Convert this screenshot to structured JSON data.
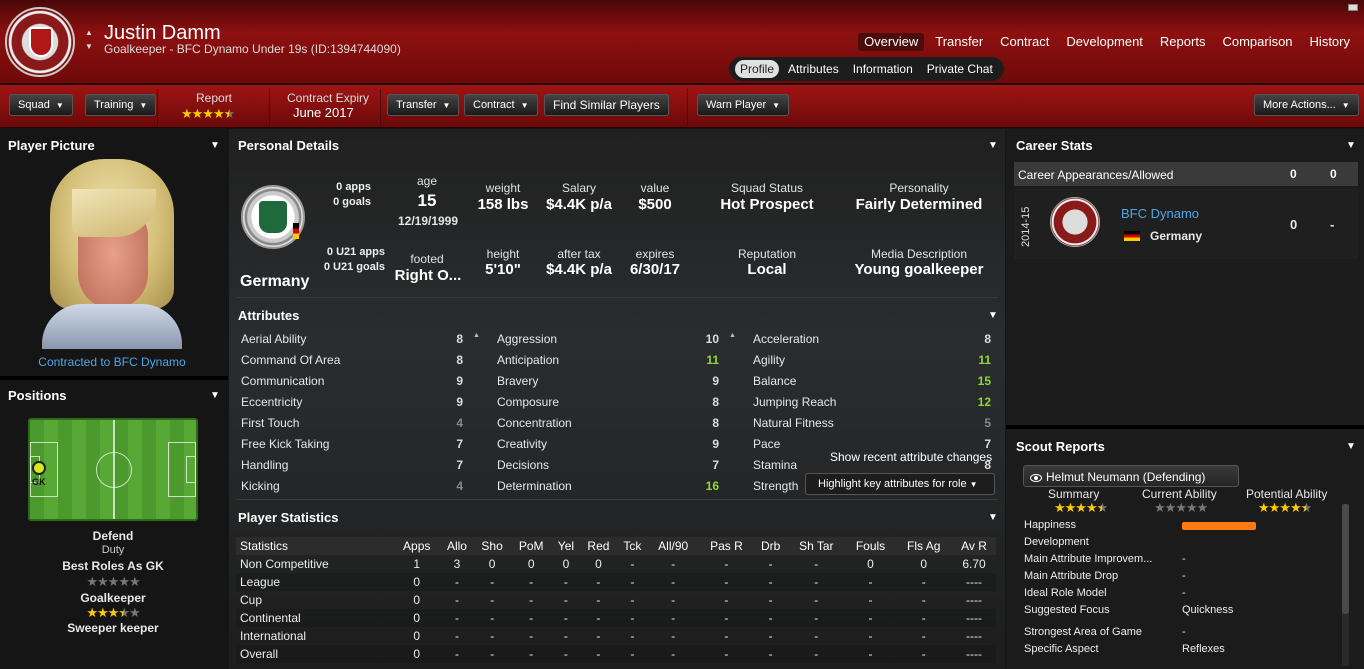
{
  "header": {
    "player_name": "Justin Damm",
    "player_subtitle": "Goalkeeper - BFC Dynamo Under 19s (ID:1394744090)",
    "nav": [
      "Overview",
      "Transfer",
      "Contract",
      "Development",
      "Reports",
      "Comparison",
      "History"
    ],
    "active_nav": "Overview",
    "sub_nav": [
      "Profile",
      "Attributes",
      "Information",
      "Private Chat"
    ],
    "active_sub_nav": "Profile"
  },
  "toolbar": {
    "squad": "Squad",
    "training": "Training",
    "report_label": "Report",
    "report_stars": 4.5,
    "contract_expiry_label": "Contract Expiry",
    "contract_expiry_value": "June 2017",
    "transfer": "Transfer",
    "contract": "Contract",
    "find_similar": "Find Similar Players",
    "warn_player": "Warn Player",
    "more_actions": "More Actions..."
  },
  "player_picture": {
    "title": "Player Picture",
    "contracted": "Contracted to BFC Dynamo"
  },
  "positions": {
    "title": "Positions",
    "pitch_label": "GK",
    "role_duty": "Defend",
    "duty_label": "Duty",
    "best_roles_label": "Best Roles As GK",
    "role1": "Goalkeeper",
    "role1_stars": 0,
    "role2": "Sweeper keeper",
    "role2_stars": 3.5
  },
  "personal": {
    "title": "Personal Details",
    "apps": "0 apps",
    "goals": "0 goals",
    "u21_apps": "0 U21 apps",
    "u21_goals": "0 U21 goals",
    "nation": "Germany",
    "age_label": "age",
    "age": "15",
    "dob": "12/19/1999",
    "footed_label": "footed",
    "footed": "Right O...",
    "weight_label": "weight",
    "weight": "158 lbs",
    "height_label": "height",
    "height": "5'10\"",
    "salary_label": "Salary",
    "salary": "$4.4K p/a",
    "after_tax_label": "after tax",
    "after_tax": "$4.4K p/a",
    "value_label": "value",
    "value": "$500",
    "expires_label": "expires",
    "expires": "6/30/17",
    "squad_status_label": "Squad Status",
    "squad_status": "Hot Prospect",
    "personality_label": "Personality",
    "personality": "Fairly Determined",
    "reputation_label": "Reputation",
    "reputation": "Local",
    "media_label": "Media Description",
    "media": "Young goalkeeper"
  },
  "attributes": {
    "title": "Attributes",
    "col1": [
      {
        "name": "Aerial Ability",
        "value": "8",
        "tone": ""
      },
      {
        "name": "Command Of Area",
        "value": "8",
        "tone": ""
      },
      {
        "name": "Communication",
        "value": "9",
        "tone": ""
      },
      {
        "name": "Eccentricity",
        "value": "9",
        "tone": ""
      },
      {
        "name": "First Touch",
        "value": "4",
        "tone": "d"
      },
      {
        "name": "Free Kick Taking",
        "value": "7",
        "tone": ""
      },
      {
        "name": "Handling",
        "value": "7",
        "tone": ""
      },
      {
        "name": "Kicking",
        "value": "4",
        "tone": "d"
      }
    ],
    "col2": [
      {
        "name": "Aggression",
        "value": "10",
        "tone": ""
      },
      {
        "name": "Anticipation",
        "value": "11",
        "tone": "g"
      },
      {
        "name": "Bravery",
        "value": "9",
        "tone": ""
      },
      {
        "name": "Composure",
        "value": "8",
        "tone": ""
      },
      {
        "name": "Concentration",
        "value": "8",
        "tone": ""
      },
      {
        "name": "Creativity",
        "value": "9",
        "tone": ""
      },
      {
        "name": "Decisions",
        "value": "7",
        "tone": ""
      },
      {
        "name": "Determination",
        "value": "16",
        "tone": "g"
      }
    ],
    "col3": [
      {
        "name": "Acceleration",
        "value": "8",
        "tone": ""
      },
      {
        "name": "Agility",
        "value": "11",
        "tone": "g"
      },
      {
        "name": "Balance",
        "value": "15",
        "tone": "g"
      },
      {
        "name": "Jumping Reach",
        "value": "12",
        "tone": "g"
      },
      {
        "name": "Natural Fitness",
        "value": "5",
        "tone": "d"
      },
      {
        "name": "Pace",
        "value": "7",
        "tone": ""
      },
      {
        "name": "Stamina",
        "value": "8",
        "tone": ""
      },
      {
        "name": "Strength",
        "value": "",
        "tone": ""
      }
    ],
    "tooltip": "Show recent attribute changes",
    "highlight_dropdown": "Highlight key attributes for role"
  },
  "statistics": {
    "title": "Player Statistics",
    "headers": [
      "Statistics",
      "Apps",
      "Allo",
      "Sho",
      "PoM",
      "Yel",
      "Red",
      "Tck",
      "All/90",
      "Pas R",
      "Drb",
      "Sh Tar",
      "Fouls",
      "Fls Ag",
      "Av R"
    ],
    "rows": [
      [
        "Non Competitive",
        "1",
        "3",
        "0",
        "0",
        "0",
        "0",
        "-",
        "-",
        "-",
        "-",
        "-",
        "0",
        "0",
        "6.70"
      ],
      [
        "League",
        "0",
        "-",
        "-",
        "-",
        "-",
        "-",
        "-",
        "-",
        "-",
        "-",
        "-",
        "-",
        "-",
        "----"
      ],
      [
        "Cup",
        "0",
        "-",
        "-",
        "-",
        "-",
        "-",
        "-",
        "-",
        "-",
        "-",
        "-",
        "-",
        "-",
        "----"
      ],
      [
        "Continental",
        "0",
        "-",
        "-",
        "-",
        "-",
        "-",
        "-",
        "-",
        "-",
        "-",
        "-",
        "-",
        "-",
        "----"
      ],
      [
        "International",
        "0",
        "-",
        "-",
        "-",
        "-",
        "-",
        "-",
        "-",
        "-",
        "-",
        "-",
        "-",
        "-",
        "----"
      ],
      [
        "Overall",
        "0",
        "-",
        "-",
        "-",
        "-",
        "-",
        "-",
        "-",
        "-",
        "-",
        "-",
        "-",
        "-",
        "----"
      ]
    ]
  },
  "career": {
    "title": "Career Stats",
    "header_label": "Career Appearances/Allowed",
    "header_v1": "0",
    "header_v2": "0",
    "season": "2014-15",
    "club": "BFC Dynamo",
    "nation": "Germany",
    "apps": "0",
    "allowed": "-"
  },
  "scout": {
    "title": "Scout Reports",
    "scout_name": "Helmut Neumann (Defending)",
    "summary_label": "Summary",
    "summary_stars": 4.5,
    "current_label": "Current Ability",
    "current_stars": 0,
    "potential_label": "Potential Ability",
    "potential_stars": 4.5,
    "happiness_level": 1.0,
    "rows": [
      {
        "k": "Happiness",
        "v": ""
      },
      {
        "k": "Development",
        "v": ""
      },
      {
        "k": "Main Attribute Improvem...",
        "v": "-"
      },
      {
        "k": "Main Attribute Drop",
        "v": "-"
      },
      {
        "k": "Ideal Role Model",
        "v": "-"
      },
      {
        "k": "Suggested Focus",
        "v": "Quickness"
      },
      {
        "k": "Strongest Area of Game",
        "v": "-"
      },
      {
        "k": "Specific Aspect",
        "v": "Reflexes"
      }
    ]
  },
  "colors": {
    "header_red": "#8e1010",
    "green_value": "#8ed83a",
    "link_blue": "#4fa6e6",
    "star_gold": "#ffcc00",
    "happiness_orange": "#ff7a10"
  }
}
